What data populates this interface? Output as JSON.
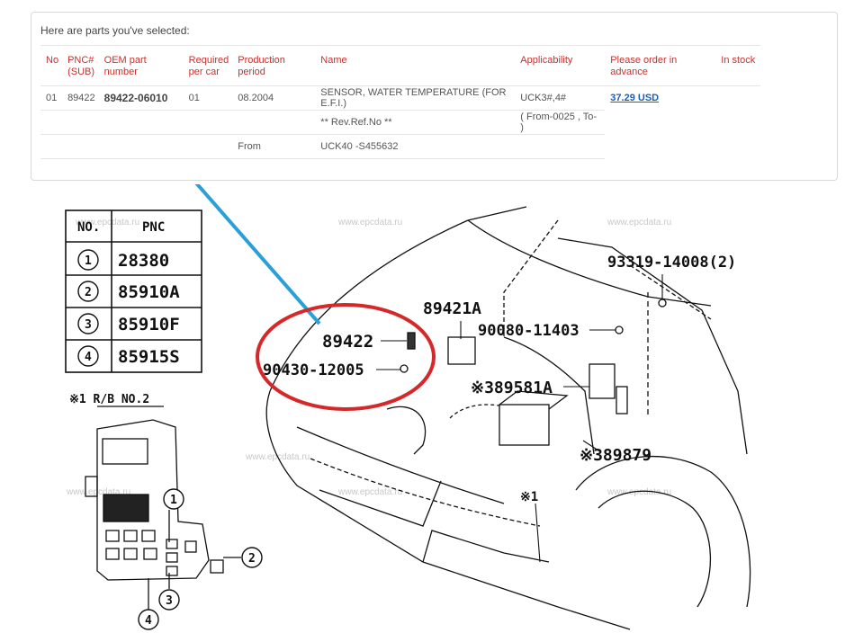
{
  "panel": {
    "title": "Here are parts you've selected:"
  },
  "table": {
    "headers": {
      "no": "No",
      "pnc": "PNC# (SUB)",
      "oem": "OEM part number",
      "required": "Required per car",
      "production": "Production period",
      "name": "Name",
      "applicability": "Applicability",
      "order": "Please order in advance",
      "stock": "In stock"
    },
    "rows": [
      {
        "no": "01",
        "pnc": "89422",
        "oem": "89422-06010",
        "required": "01",
        "production": "08.2004",
        "name": "SENSOR, WATER TEMPERATURE (FOR E.F.I.)",
        "applicability": "UCK3#,4#",
        "price": "37.29 USD"
      },
      {
        "name": "** Rev.Ref.No **",
        "applicability": "( From-0025 , To- )"
      },
      {
        "production": "From",
        "name": "UCK40 -S455632"
      }
    ]
  },
  "diagram": {
    "watermark": "www.epcdata.ru",
    "pnc_table": {
      "col_no": "NO.",
      "col_pnc": "PNC",
      "rows": [
        {
          "no": "1",
          "pnc": "28380"
        },
        {
          "no": "2",
          "pnc": "85910A"
        },
        {
          "no": "3",
          "pnc": "85910F"
        },
        {
          "no": "4",
          "pnc": "85915S"
        }
      ]
    },
    "rb_label": "※1  R/B NO.2",
    "callouts": {
      "c89421a": "89421A",
      "c90080": "90080-11403",
      "c93319": "93319-14008(2)",
      "c89422": "89422",
      "c90430": "90430-12005",
      "c89581a": "※389581A",
      "c89879": "※389879",
      "cx1": "※1"
    },
    "colors": {
      "highlight_circle": "#d62828",
      "pointer_line": "#2a9fd8"
    }
  }
}
